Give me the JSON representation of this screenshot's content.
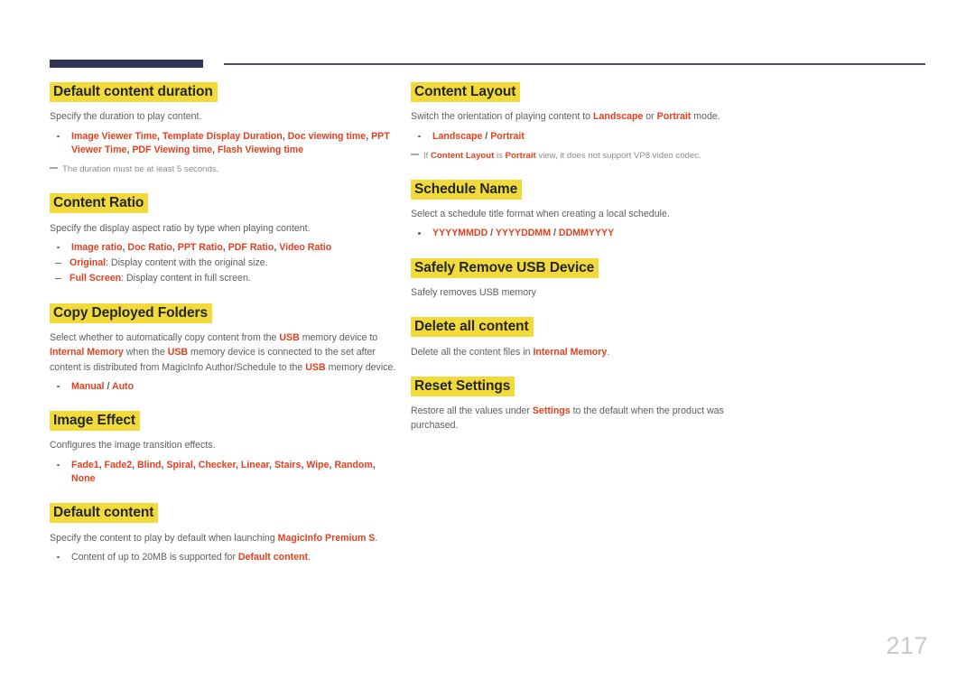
{
  "page": {
    "number": "217",
    "accent_red": "#e4401f",
    "highlight_yellow": "#f2da3a",
    "rule_navy": "#2e3355",
    "body_gray": "#5e5e5e"
  },
  "left_column": [
    {
      "title": "Default content duration",
      "body_parts": [
        {
          "t": "Specify the duration to play content.",
          "kw": false
        }
      ],
      "bullets": [
        {
          "kw": true,
          "parts": [
            {
              "t": "Image Viewer Time",
              "kw": true
            },
            {
              "t": ", ",
              "kw": false
            },
            {
              "t": "Template Display Duration",
              "kw": true
            },
            {
              "t": ", ",
              "kw": false
            },
            {
              "t": "Doc viewing time",
              "kw": true
            },
            {
              "t": ", ",
              "kw": false
            },
            {
              "t": "PPT Viewer Time",
              "kw": true
            },
            {
              "t": ", ",
              "kw": false
            },
            {
              "t": "PDF Viewing time",
              "kw": true
            },
            {
              "t": ", ",
              "kw": false
            },
            {
              "t": "Flash Viewing time",
              "kw": true
            }
          ]
        }
      ],
      "sub_bullets": [],
      "note": [
        {
          "t": "The duration must be at least 5 seconds.",
          "kw": false
        }
      ]
    },
    {
      "title": "Content Ratio",
      "body_parts": [
        {
          "t": "Specify the display aspect ratio by type when playing content.",
          "kw": false
        }
      ],
      "bullets": [
        {
          "kw": true,
          "parts": [
            {
              "t": "Image ratio",
              "kw": true
            },
            {
              "t": ", ",
              "kw": false
            },
            {
              "t": "Doc Ratio",
              "kw": true
            },
            {
              "t": ", ",
              "kw": false
            },
            {
              "t": "PPT Ratio",
              "kw": true
            },
            {
              "t": ", ",
              "kw": false
            },
            {
              "t": "PDF Ratio",
              "kw": true
            },
            {
              "t": ", ",
              "kw": false
            },
            {
              "t": "Video Ratio",
              "kw": true
            }
          ]
        }
      ],
      "sub_bullets": [
        {
          "parts": [
            {
              "t": "Original",
              "kw": true
            },
            {
              "t": ": Display content with the original size.",
              "kw": false
            }
          ]
        },
        {
          "parts": [
            {
              "t": "Full Screen",
              "kw": true
            },
            {
              "t": ": Display content in full screen.",
              "kw": false
            }
          ]
        }
      ],
      "note": null
    },
    {
      "title": "Copy Deployed Folders",
      "body_parts": [
        {
          "t": "Select whether to automatically copy content from the ",
          "kw": false
        },
        {
          "t": "USB",
          "kw": true
        },
        {
          "t": " memory device to ",
          "kw": false
        },
        {
          "t": "Internal Memory",
          "kw": true
        },
        {
          "t": " when the ",
          "kw": false
        },
        {
          "t": "USB",
          "kw": true
        },
        {
          "t": " memory device is connected to the set after content is distributed from MagicInfo Author/Schedule to the ",
          "kw": false
        },
        {
          "t": "USB",
          "kw": true
        },
        {
          "t": " memory device.",
          "kw": false
        }
      ],
      "bullets": [
        {
          "kw": true,
          "parts": [
            {
              "t": "Manual",
              "kw": true
            },
            {
              "t": " / ",
              "kw": false
            },
            {
              "t": "Auto",
              "kw": true
            }
          ]
        }
      ],
      "sub_bullets": [],
      "note": null
    },
    {
      "title": "Image Effect",
      "body_parts": [
        {
          "t": "Configures the image transition effects.",
          "kw": false
        }
      ],
      "bullets": [
        {
          "kw": true,
          "parts": [
            {
              "t": "Fade1",
              "kw": true
            },
            {
              "t": ", ",
              "kw": false
            },
            {
              "t": "Fade2",
              "kw": true
            },
            {
              "t": ", ",
              "kw": false
            },
            {
              "t": "Blind",
              "kw": true
            },
            {
              "t": ", ",
              "kw": false
            },
            {
              "t": "Spiral",
              "kw": true
            },
            {
              "t": ", ",
              "kw": false
            },
            {
              "t": "Checker",
              "kw": true
            },
            {
              "t": ", ",
              "kw": false
            },
            {
              "t": "Linear",
              "kw": true
            },
            {
              "t": ", ",
              "kw": false
            },
            {
              "t": "Stairs",
              "kw": true
            },
            {
              "t": ", ",
              "kw": false
            },
            {
              "t": "Wipe",
              "kw": true
            },
            {
              "t": ", ",
              "kw": false
            },
            {
              "t": "Random",
              "kw": true
            },
            {
              "t": ", ",
              "kw": false
            },
            {
              "t": "None",
              "kw": true
            }
          ]
        }
      ],
      "sub_bullets": [],
      "note": null
    },
    {
      "title": "Default content",
      "body_parts": [
        {
          "t": "Specify the content to play by default when launching ",
          "kw": false
        },
        {
          "t": "MagicInfo Premium S",
          "kw": true
        },
        {
          "t": ".",
          "kw": false
        }
      ],
      "bullets": [
        {
          "kw": false,
          "parts": [
            {
              "t": "Content of up to 20MB is supported for ",
              "kw": false
            },
            {
              "t": "Default content",
              "kw": true
            },
            {
              "t": ".",
              "kw": false
            }
          ]
        }
      ],
      "sub_bullets": [],
      "note": null
    }
  ],
  "right_column": [
    {
      "title": "Content Layout",
      "body_parts": [
        {
          "t": "Switch the orientation of playing content to ",
          "kw": false
        },
        {
          "t": "Landscape",
          "kw": true
        },
        {
          "t": " or ",
          "kw": false
        },
        {
          "t": "Portrait",
          "kw": true
        },
        {
          "t": " mode.",
          "kw": false
        }
      ],
      "bullets": [
        {
          "kw": true,
          "parts": [
            {
              "t": "Landscape",
              "kw": true
            },
            {
              "t": " / ",
              "kw": false
            },
            {
              "t": "Portrait",
              "kw": true
            }
          ]
        }
      ],
      "sub_bullets": [],
      "note": [
        {
          "t": "If ",
          "kw": false
        },
        {
          "t": "Content Layout",
          "kw": true
        },
        {
          "t": " is ",
          "kw": false
        },
        {
          "t": "Portrait",
          "kw": true
        },
        {
          "t": " view, it does not support VP8 video codec.",
          "kw": false
        }
      ]
    },
    {
      "title": "Schedule Name",
      "body_parts": [
        {
          "t": "Select a schedule title format when creating a local schedule.",
          "kw": false
        }
      ],
      "bullets": [
        {
          "kw": true,
          "parts": [
            {
              "t": "YYYYMMDD",
              "kw": true
            },
            {
              "t": " / ",
              "kw": false
            },
            {
              "t": "YYYYDDMM",
              "kw": true
            },
            {
              "t": " / ",
              "kw": false
            },
            {
              "t": "DDMMYYYY",
              "kw": true
            }
          ]
        }
      ],
      "sub_bullets": [],
      "note": null
    },
    {
      "title": "Safely Remove USB Device",
      "body_parts": [
        {
          "t": "Safely removes USB memory",
          "kw": false
        }
      ],
      "bullets": [],
      "sub_bullets": [],
      "note": null
    },
    {
      "title": "Delete all content",
      "body_parts": [
        {
          "t": "Delete all the content files in ",
          "kw": false
        },
        {
          "t": "Internal Memory",
          "kw": true
        },
        {
          "t": ".",
          "kw": false
        }
      ],
      "bullets": [],
      "sub_bullets": [],
      "note": null
    },
    {
      "title": "Reset Settings",
      "body_parts": [
        {
          "t": "Restore all the values under ",
          "kw": false
        },
        {
          "t": "Settings",
          "kw": true
        },
        {
          "t": " to the default when the product was purchased.",
          "kw": false
        }
      ],
      "bullets": [],
      "sub_bullets": [],
      "note": null
    }
  ]
}
